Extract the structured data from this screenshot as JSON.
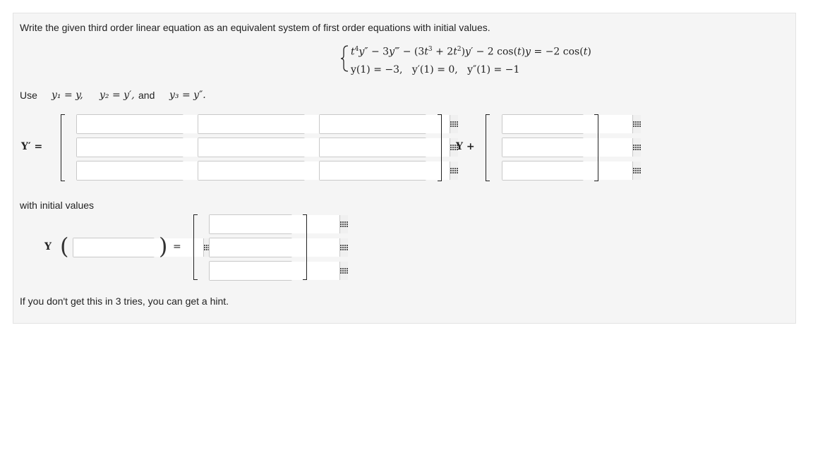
{
  "instruction": "Write the given third order linear equation as an equivalent system of first order equations with initial values.",
  "equation": {
    "line1": {
      "t4": "t",
      "sup4": "4",
      "y_dd": "y″",
      "minus1": " − 3",
      "y_ddd": "y‴",
      "minus2": " − (3",
      "t3": "t",
      "sup3": "3",
      "plus": " + 2",
      "t2": "t",
      "sup2": "2",
      "close": ")",
      "yp": "y′",
      "minus3": " − 2 cos(",
      "tvar": "t",
      "close2": ")",
      "yvar": "y",
      "rhs": " = −2 cos(",
      "tvar2": "t",
      "close3": ")"
    },
    "line2": {
      "c1": "y(1) = −3,",
      "c2": "y′(1) = 0,",
      "c3": "y″(1) = −1"
    }
  },
  "use": {
    "label": "Use",
    "y1": "y₁ = y,",
    "y2": "y₂ = y′, ",
    "and": "and",
    "y3": "y₃ = y″."
  },
  "system": {
    "lhs": "Y′ =",
    "plus_label": "Y +"
  },
  "initial": {
    "label": "with initial values",
    "Y": "Y",
    "equals": "="
  },
  "hint": "If you don't get this in 3 tries, you can get a hint."
}
